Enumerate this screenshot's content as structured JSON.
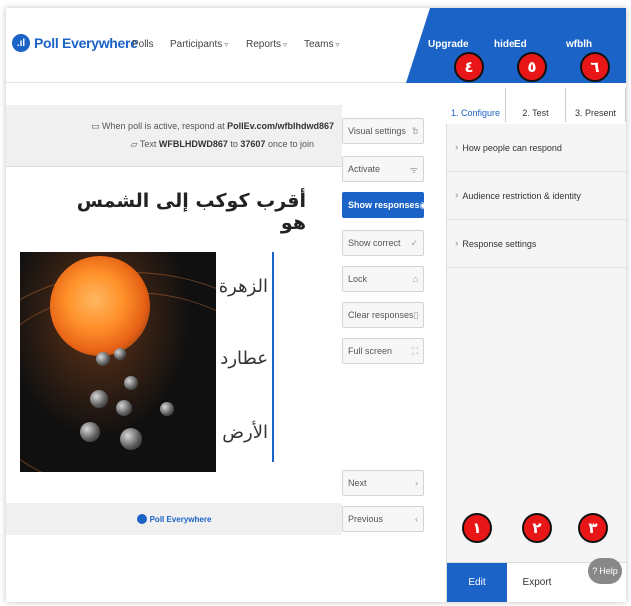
{
  "header": {
    "logo_text": "Poll Everywhere",
    "nav": [
      "Polls",
      "Participants",
      "Reports",
      "Teams"
    ],
    "upgrade": "Upgrade",
    "hide": "hide",
    "edit_user": "Ed",
    "user": "wfblh"
  },
  "steps": [
    "1. Configure",
    "2. Test",
    "3. Present"
  ],
  "badges": {
    "b1": "١",
    "b2": "٢",
    "b3": "٣",
    "b4": "٤",
    "b5": "٥",
    "b6": "٦"
  },
  "info": {
    "respond_prefix": "When poll is active, respond at",
    "respond_url": "PollEv.com/wfblhdwd867",
    "text_prefix": "Text",
    "text_code": "WFBLHDWD867",
    "text_to": "to",
    "text_number": "37607",
    "text_suffix": "once to join"
  },
  "question": "أقرب كوكب إلى الشمس هو",
  "answers": [
    "الزهرة",
    "عطارد",
    "الأرض"
  ],
  "controls": {
    "visual_settings": "Visual settings",
    "activate": "Activate",
    "show_responses": "Show responses",
    "show_correct": "Show correct",
    "lock": "Lock",
    "clear_responses": "Clear responses",
    "full_screen": "Full screen",
    "next": "Next",
    "previous": "Previous"
  },
  "panel": {
    "items": [
      "How people can respond",
      "Audience restriction & identity",
      "Response settings"
    ],
    "tabs": [
      "Edit",
      "Export"
    ],
    "help": "Help"
  },
  "footer_logo": "Poll Everywhere",
  "colors": {
    "brand": "#1b63c6",
    "badge": "#e81616"
  }
}
